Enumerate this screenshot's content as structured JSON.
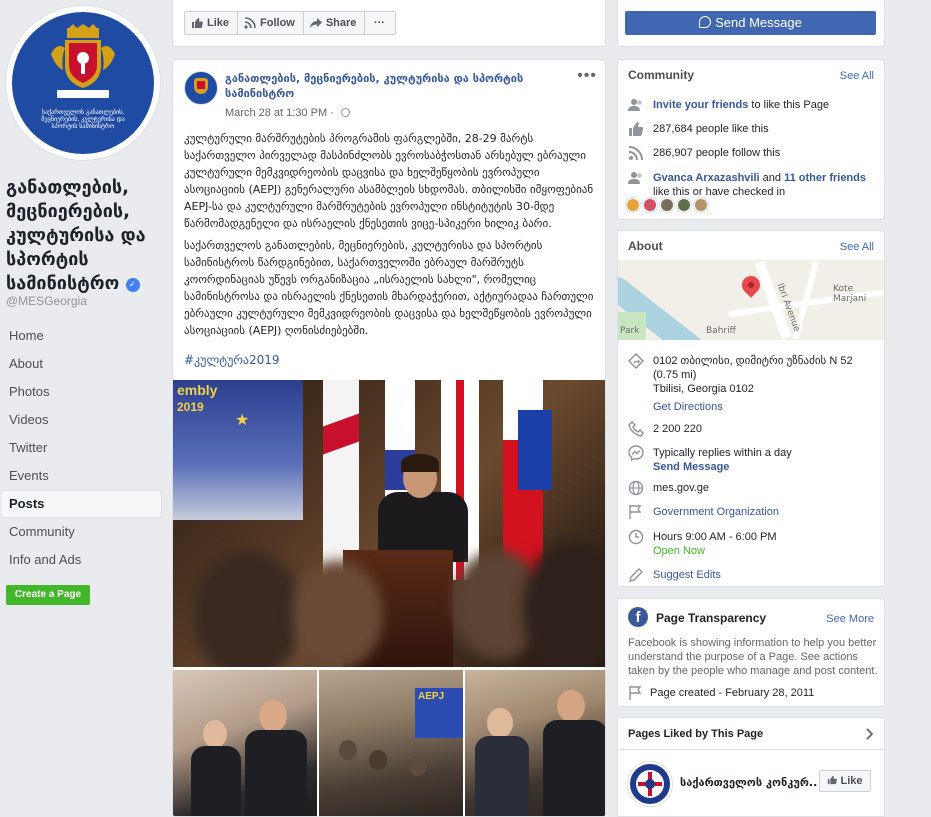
{
  "page": {
    "name": "განათლების, მეცნიერების, კულტურისა და სპორტის სამინისტრო",
    "handle": "@MESGeorgia",
    "verified_icon": "verified-badge-icon"
  },
  "profile_pic": {
    "seal_year": "1932 ᲬᲚᲘᲓᲐᲜ",
    "seal_text": "საქართველოს განათლების, მეცნიერების, კულტურისა და სპორტის სამინისტრო"
  },
  "nav": {
    "items": [
      {
        "label": "Home"
      },
      {
        "label": "About"
      },
      {
        "label": "Photos"
      },
      {
        "label": "Videos"
      },
      {
        "label": "Twitter"
      },
      {
        "label": "Events"
      },
      {
        "label": "Posts"
      },
      {
        "label": "Community"
      },
      {
        "label": "Info and Ads"
      }
    ],
    "active": "Posts",
    "create_page": "Create a Page"
  },
  "action_bar": {
    "like": "Like",
    "follow": "Follow",
    "share": "Share",
    "more": "···"
  },
  "send_message": "Send Message",
  "post": {
    "author": "განათლების, მეცნიერების, კულტურისა და სპორტის სამინისტრო",
    "timestamp": "March 28 at 1:30 PM · ",
    "more": "•••",
    "paragraph1": "კულტურული მარშრუტების პროგრამის ფარგლებში, 28-29 მარტს საქართველო პირველად მასპინძლობს ევროსაბჭოსთან არსებულ ებრაული კულტურული მემკვიდრეობის დაცვისა და ხელშეწყობის ევროპული ასოციაციის (AEPJ) გენერალური ასამბლეის სხდომას. თბილისში იმყოფებიან AEPJ-სა და კულტურული მარშრუტების ევროპული ინსტიტუტის 30-მდე წარმომადგენელი და ისრაელის ქნესეთის ვიცე-სპიკერი ხილიკ ბარი.",
    "paragraph2": "საქართველოს განათლების, მეცნიერების, კულტურისა და სპორტის სამინისტროს წარდგინებით, საქართველოში ებრაულ მარშრუტს კოორდინაციას უწევს ორგანიზაცია „ისრაელის სახლი\", რომელიც სამინისტროსა და ისრაელის ქნესეთის მხარდაჭერით, აქტიურადაა ჩართული ებრაული კულტურული მემკვიდრეობის დაცვისა და ხელშეწყობის ევროპული ასოციაციის (AEPJ) ღონისძიებებში.",
    "hashtag": "#კულტურა2019",
    "screen_line1": "embly",
    "screen_line2": "2019",
    "thumb3_banner": "AEPJ"
  },
  "community": {
    "title": "Community",
    "see_all": "See All",
    "invite_link": "Invite your friends",
    "invite_rest": " to like this Page",
    "likes": "287,684 people like this",
    "follows": "286,907 people follow this",
    "friend_name": "Gvanca Arxazashvili",
    "friend_and": " and ",
    "friend_others": "11 other friends",
    "friend_rest": "like this or have checked in"
  },
  "about": {
    "title": "About",
    "see_all": "See All",
    "map_labels": [
      "Kote Marjani",
      "Park",
      "Bahriff",
      "Ibri Avenue"
    ],
    "address_line1": "0102 თბილისი, დიმიტრი უზნაძის N 52 (0.75 mi)",
    "address_line2": "Tbilisi, Georgia 0102",
    "get_directions": "Get Directions",
    "phone": "2 200 220",
    "replies": "Typically replies within a day",
    "send_message": "Send Message",
    "website": "mes.gov.ge",
    "category": "Government Organization",
    "hours": "Hours 9:00 AM - 6:00 PM",
    "open_now": "Open Now",
    "suggest_edits": "Suggest Edits"
  },
  "transparency": {
    "title": "Page Transparency",
    "see_more": "See More",
    "description": "Facebook is showing information to help you better understand the purpose of a Page. See actions taken by the people who manage and post content.",
    "created": "Page created - February 28, 2011"
  },
  "pages_liked": {
    "title": "Pages Liked by This Page",
    "page_name": "საქართველოს კონკურ...",
    "like": "Like"
  },
  "colors": {
    "brand_blue": "#4267b2",
    "link_blue": "#385898",
    "green": "#42b72a",
    "background": "#e9ebee"
  }
}
